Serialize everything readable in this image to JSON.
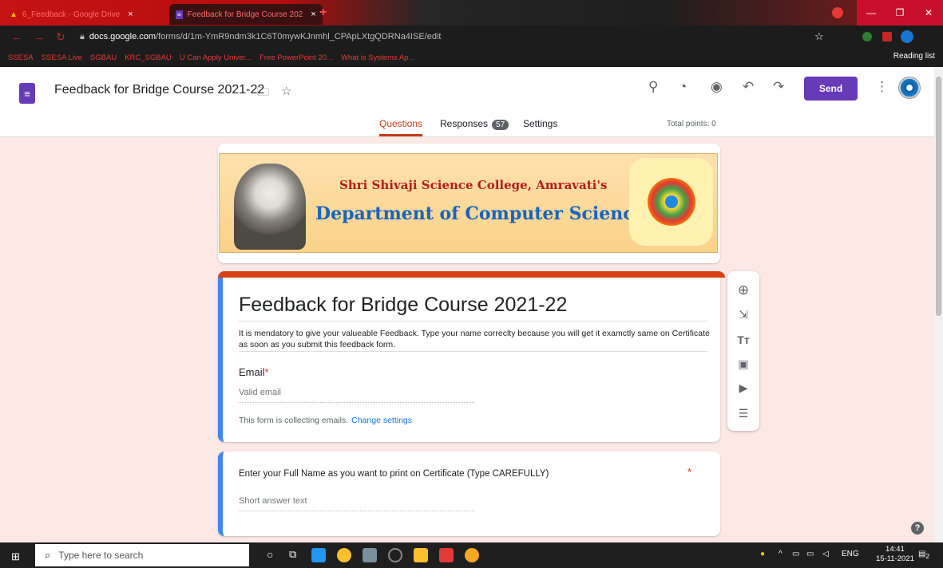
{
  "browser": {
    "tabs": [
      {
        "title": "6_Feedback - Google Drive",
        "close": "×"
      },
      {
        "title": "Feedback for Bridge Course 202",
        "close": "×"
      }
    ],
    "new_tab": "+",
    "url_host": "docs.google.com",
    "url_path": "/forms/d/1m-YmR9ndm3k1C6T0mywKJnmhl_CPApLXtgQDRNa4ISE/edit",
    "bookmarks": [
      "SSESA",
      "SSESA Live",
      "SGBAU",
      "KRC_SGBAU",
      "U Can Apply Univer...",
      "Free PowerPoint 20...",
      "What is Systems Ap..."
    ],
    "reading_list": "Reading list"
  },
  "form_header": {
    "title": "Feedback for Bridge Course 2021-22",
    "send_label": "Send",
    "tabs": {
      "questions": "Questions",
      "responses": "Responses",
      "responses_count": "57",
      "settings": "Settings"
    },
    "total_points": "Total points: 0"
  },
  "banner": {
    "line1": "Shri Shivaji Science College, Amravati's",
    "line2": "Department of Computer Science"
  },
  "title_card": {
    "title": "Feedback for Bridge Course 2021-22",
    "description": "It is mendatory to give your valueable Feedback. Type your name correclty because you will get it examctly same on Certificate as soon as you submit this feedback form.",
    "email_label": "Email",
    "required_mark": "*",
    "email_placeholder": "Valid email",
    "collect_text": "This form is collecting emails.",
    "change_settings": "Change settings"
  },
  "question1": {
    "text": "Enter your Full Name as you want to print on Certificate (Type CAREFULLY)",
    "required_mark": "*",
    "placeholder": "Short answer text"
  },
  "help": "?",
  "taskbar": {
    "search_placeholder": "Type here to search",
    "lang": "ENG",
    "time": "14:41",
    "date": "15-11-2021",
    "notif_count": "2"
  }
}
